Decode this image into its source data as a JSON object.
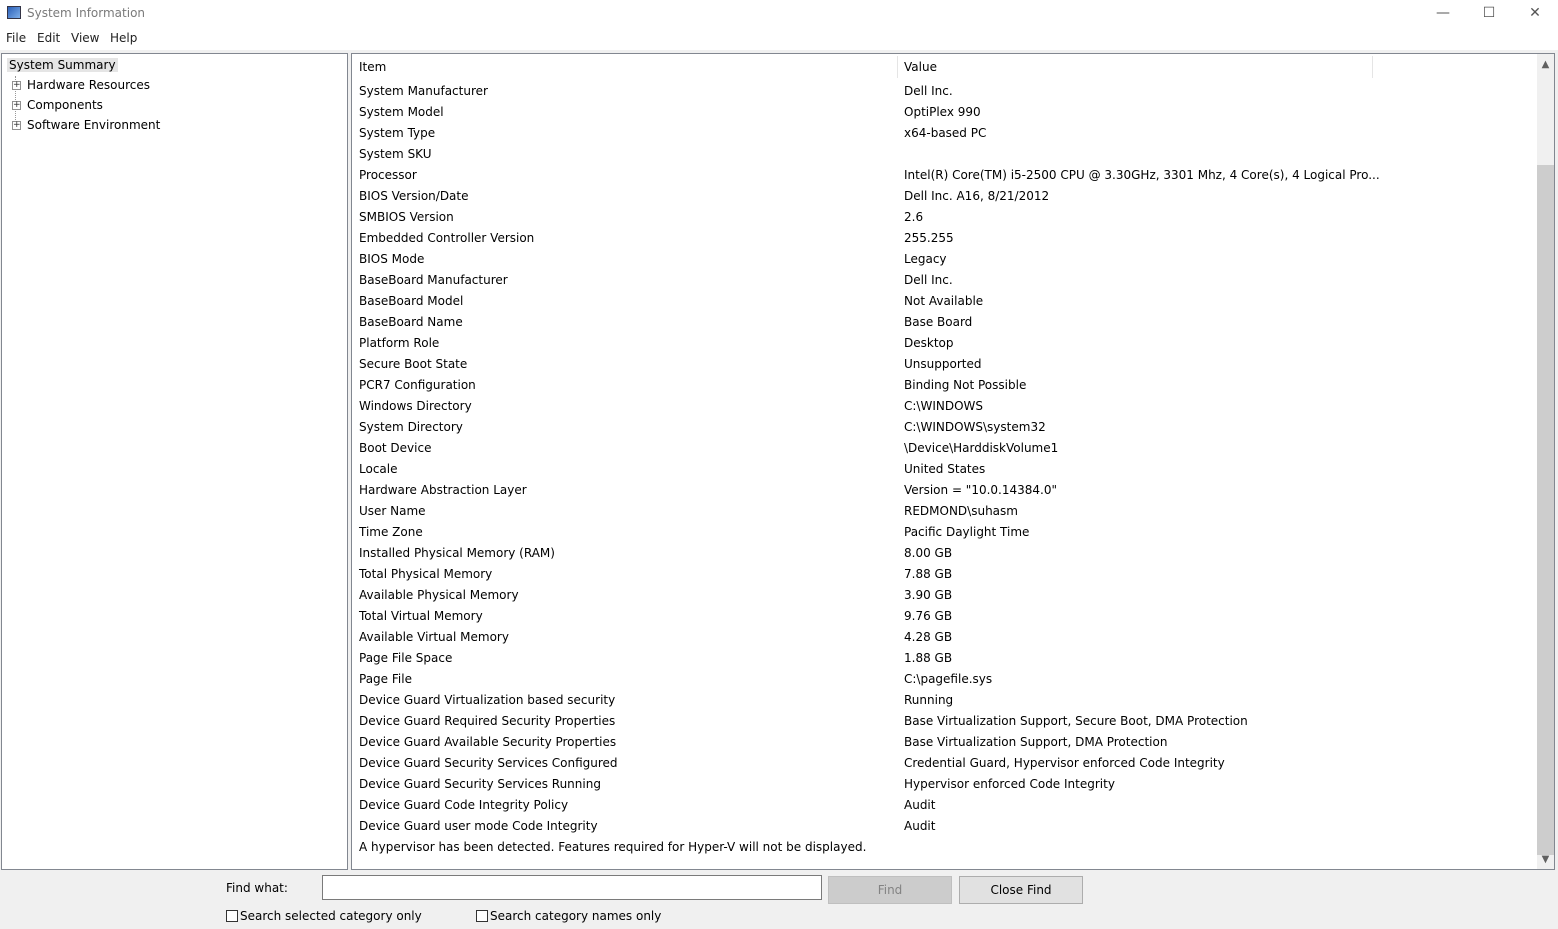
{
  "window": {
    "title": "System Information",
    "minimize": "—",
    "maximize": "☐",
    "close": "✕"
  },
  "menu": [
    "File",
    "Edit",
    "View",
    "Help"
  ],
  "tree": {
    "items": [
      {
        "label": "System Summary",
        "selected": true
      },
      {
        "label": "Hardware Resources"
      },
      {
        "label": "Components"
      },
      {
        "label": "Software Environment"
      }
    ],
    "expander": "+"
  },
  "table": {
    "columns": [
      "Item",
      "Value"
    ],
    "rows": [
      [
        "System Manufacturer",
        "Dell Inc."
      ],
      [
        "System Model",
        "OptiPlex 990"
      ],
      [
        "System Type",
        "x64-based PC"
      ],
      [
        "System SKU",
        ""
      ],
      [
        "Processor",
        "Intel(R) Core(TM) i5-2500 CPU @ 3.30GHz, 3301 Mhz, 4 Core(s), 4 Logical Pro..."
      ],
      [
        "BIOS Version/Date",
        "Dell Inc. A16, 8/21/2012"
      ],
      [
        "SMBIOS Version",
        "2.6"
      ],
      [
        "Embedded Controller Version",
        "255.255"
      ],
      [
        "BIOS Mode",
        "Legacy"
      ],
      [
        "BaseBoard Manufacturer",
        "Dell Inc."
      ],
      [
        "BaseBoard Model",
        "Not Available"
      ],
      [
        "BaseBoard Name",
        "Base Board"
      ],
      [
        "Platform Role",
        "Desktop"
      ],
      [
        "Secure Boot State",
        "Unsupported"
      ],
      [
        "PCR7 Configuration",
        "Binding Not Possible"
      ],
      [
        "Windows Directory",
        "C:\\WINDOWS"
      ],
      [
        "System Directory",
        "C:\\WINDOWS\\system32"
      ],
      [
        "Boot Device",
        "\\Device\\HarddiskVolume1"
      ],
      [
        "Locale",
        "United States"
      ],
      [
        "Hardware Abstraction Layer",
        "Version = \"10.0.14384.0\""
      ],
      [
        "User Name",
        "REDMOND\\suhasm"
      ],
      [
        "Time Zone",
        "Pacific Daylight Time"
      ],
      [
        "Installed Physical Memory (RAM)",
        "8.00 GB"
      ],
      [
        "Total Physical Memory",
        "7.88 GB"
      ],
      [
        "Available Physical Memory",
        "3.90 GB"
      ],
      [
        "Total Virtual Memory",
        "9.76 GB"
      ],
      [
        "Available Virtual Memory",
        "4.28 GB"
      ],
      [
        "Page File Space",
        "1.88 GB"
      ],
      [
        "Page File",
        "C:\\pagefile.sys"
      ],
      [
        "Device Guard Virtualization based security",
        "Running"
      ],
      [
        "Device Guard Required Security Properties",
        "Base Virtualization Support, Secure Boot, DMA Protection"
      ],
      [
        "Device Guard Available Security Properties",
        "Base Virtualization Support, DMA Protection"
      ],
      [
        "Device Guard Security Services Configured",
        "Credential Guard, Hypervisor enforced Code Integrity"
      ],
      [
        "Device Guard Security Services Running",
        "Hypervisor enforced Code Integrity"
      ],
      [
        "Device Guard Code Integrity Policy",
        "Audit"
      ],
      [
        "Device Guard user mode Code Integrity",
        "Audit"
      ],
      [
        "A hypervisor has been detected. Features required for Hyper-V will not be displayed.",
        ""
      ]
    ]
  },
  "scroll": {
    "up": "▲",
    "down": "▼"
  },
  "find": {
    "label": "Find what:",
    "value": "",
    "find_button": "Find",
    "close_button": "Close Find",
    "check1": "Search selected category only",
    "check2": "Search category names only"
  }
}
